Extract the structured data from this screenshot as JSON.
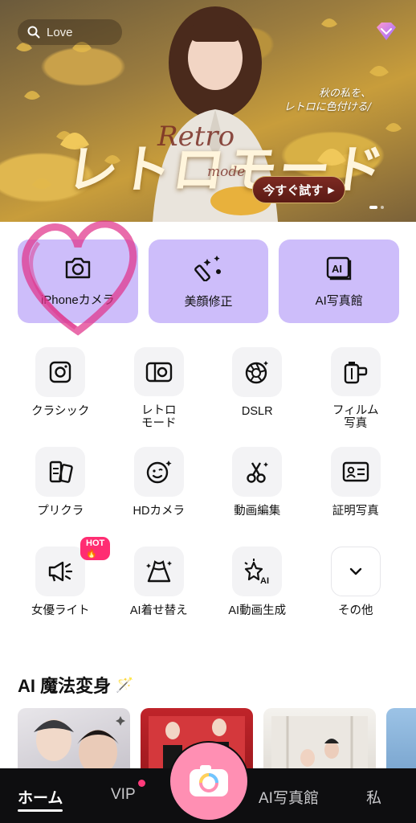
{
  "hero": {
    "search_text": "Love",
    "title_retro": "Retro",
    "title_mode_small": "mode",
    "title_main": "レトロモード",
    "subtitle_line1": "秋の私を、",
    "subtitle_line2": "レトロに色付ける/",
    "cta_label": "今すぐ試す",
    "cta_arrow": "▶",
    "slide_indicator": {
      "total": 2,
      "active": 1
    }
  },
  "primary_cards": [
    {
      "label": "iPhoneカメラ",
      "icon": "camera-icon"
    },
    {
      "label": "美顔修正",
      "icon": "magic-wand-icon"
    },
    {
      "label": "AI写真館",
      "icon": "ai-photo-icon"
    }
  ],
  "tools": [
    {
      "label": "クラシック",
      "icon": "instant-camera-icon"
    },
    {
      "label": "レトロ\nモード",
      "icon": "retro-camera-icon"
    },
    {
      "label": "DSLR",
      "icon": "aperture-icon"
    },
    {
      "label": "フィルム\n写真",
      "icon": "film-roll-icon"
    },
    {
      "label": "プリクラ",
      "icon": "photo-cards-icon"
    },
    {
      "label": "HDカメラ",
      "icon": "smiley-sparkle-icon"
    },
    {
      "label": "動画編集",
      "icon": "scissors-icon"
    },
    {
      "label": "証明写真",
      "icon": "id-card-icon"
    },
    {
      "label": "女優ライト",
      "icon": "spotlight-icon",
      "badge": "HOT🔥"
    },
    {
      "label": "AI着せ替え",
      "icon": "dress-icon"
    },
    {
      "label": "AI動画生成",
      "icon": "ai-star-icon"
    },
    {
      "label": "その他",
      "icon": "chevron-down-icon"
    }
  ],
  "section": {
    "title": "AI 魔法変身",
    "emoji": "🪄"
  },
  "bottom_nav": {
    "home": "ホーム",
    "vip": "VIP",
    "ai_studio": "AI写真館",
    "me": "私"
  },
  "colors": {
    "card_purple": "#cdbdfa",
    "tool_bg": "#f3f3f5",
    "nav_bg": "#0e0e10",
    "camera_pink": "#ff8fb3",
    "hot_pink": "#ff2d72"
  }
}
